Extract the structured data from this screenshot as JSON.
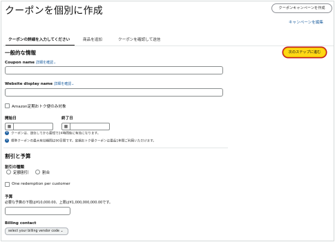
{
  "header": {
    "title": "クーポンを個別に作成",
    "campaign_button": "クーポンキャンペーンを作成",
    "campaign_link": "キャンペーンを編集"
  },
  "tabs": [
    {
      "label": "クーポンの詳細を入力してください",
      "active": true
    },
    {
      "label": "商品を追加",
      "active": false
    },
    {
      "label": "クーポンを確認して送信",
      "active": false
    }
  ],
  "next_button": "次のステップに進む",
  "general": {
    "heading": "一般的な情報",
    "coupon_name_label": "Coupon name",
    "coupon_name_more": "詳細を確認",
    "coupon_name_value": "",
    "website_name_label": "Website display name",
    "website_name_more": "詳細を確認",
    "website_name_value": "",
    "subscribe_only_label": "Amazon定期おトク便のみ対象"
  },
  "dates": {
    "start_label": "開始日",
    "end_label": "終了日",
    "start_value": "",
    "end_value": "",
    "info1": "クーポンは、送信してから最短で24時間後に有効になります。",
    "info2": "標準クーポンの最大有効期間は90日間です。定期おトク便クーポンは最長1年間ご利用いただけます。"
  },
  "discount": {
    "heading": "割引と予算",
    "type_label": "割引の種類",
    "option_fixed": "定額割引",
    "option_percent": "割合",
    "one_redemption_label": "One redemption per customer",
    "budget_label": "予算",
    "budget_hint": "必要な予算の下限は¥10,000.00、上限は¥1,000,000,000.00です。",
    "budget_value": ""
  },
  "billing": {
    "label": "Billing contact",
    "select_value": "select your billing vendor code"
  },
  "colors": {
    "link": "#2162a1",
    "primary_button": "#ffd814",
    "highlight_outline": "#c7191f"
  }
}
